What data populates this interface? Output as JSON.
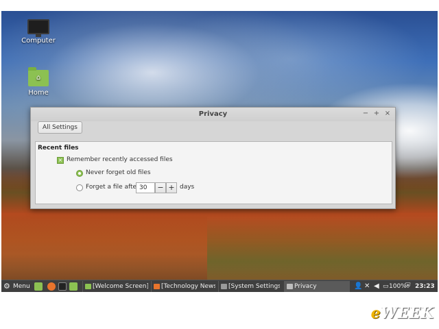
{
  "desktop": {
    "icons": [
      {
        "label": "Computer",
        "icon": "computer-icon"
      },
      {
        "label": "Home",
        "icon": "home-folder-icon"
      }
    ]
  },
  "window": {
    "title": "Privacy",
    "controls": {
      "minimize": "−",
      "maximize": "+",
      "close": "×"
    },
    "toolbar": {
      "all_settings_label": "All Settings"
    },
    "section": {
      "title": "Recent files",
      "remember_label": "Remember recently accessed files",
      "remember_checked": true,
      "never_forget_label": "Never forget old files",
      "never_forget_selected": true,
      "forget_after_label": "Forget a file after",
      "forget_after_value": "30",
      "minus_label": "−",
      "plus_label": "+",
      "days_label": "days"
    }
  },
  "taskbar": {
    "menu_label": "Menu",
    "tasks": [
      {
        "label": "[Welcome Screen]",
        "active": false
      },
      {
        "label": "[Technology News...",
        "active": false
      },
      {
        "label": "[System Settings]",
        "active": false
      },
      {
        "label": "Privacy",
        "active": true
      }
    ],
    "battery": "100%",
    "clock": "23:23"
  },
  "watermark": {
    "first": "e",
    "rest": "WEEK"
  },
  "colors": {
    "accent": "#8cc152",
    "taskbar": "#3f3f3f",
    "watermark": "#f0b400"
  }
}
